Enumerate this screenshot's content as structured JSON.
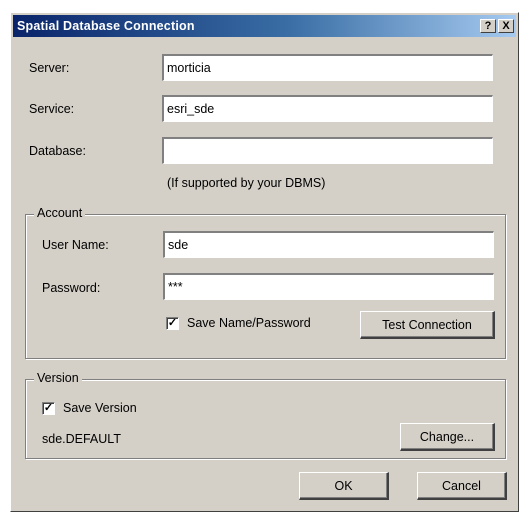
{
  "window": {
    "title": "Spatial Database Connection",
    "help_label": "?",
    "close_label": "X"
  },
  "fields": {
    "server": {
      "label": "Server:",
      "value": "morticia"
    },
    "service": {
      "label": "Service:",
      "value": "esri_sde"
    },
    "database": {
      "label": "Database:",
      "value": "",
      "hint": "(If supported by your DBMS)"
    }
  },
  "account": {
    "legend": "Account",
    "username": {
      "label": "User Name:",
      "value": "sde"
    },
    "password": {
      "label": "Password:",
      "value": "***"
    },
    "save_checkbox": {
      "label": "Save Name/Password",
      "checked": true,
      "mark": "✓"
    },
    "test_button": "Test Connection"
  },
  "version": {
    "legend": "Version",
    "save_checkbox": {
      "label": "Save Version",
      "checked": true,
      "mark": "✓"
    },
    "current": "sde.DEFAULT",
    "change_button": "Change..."
  },
  "buttons": {
    "ok": "OK",
    "cancel": "Cancel"
  }
}
